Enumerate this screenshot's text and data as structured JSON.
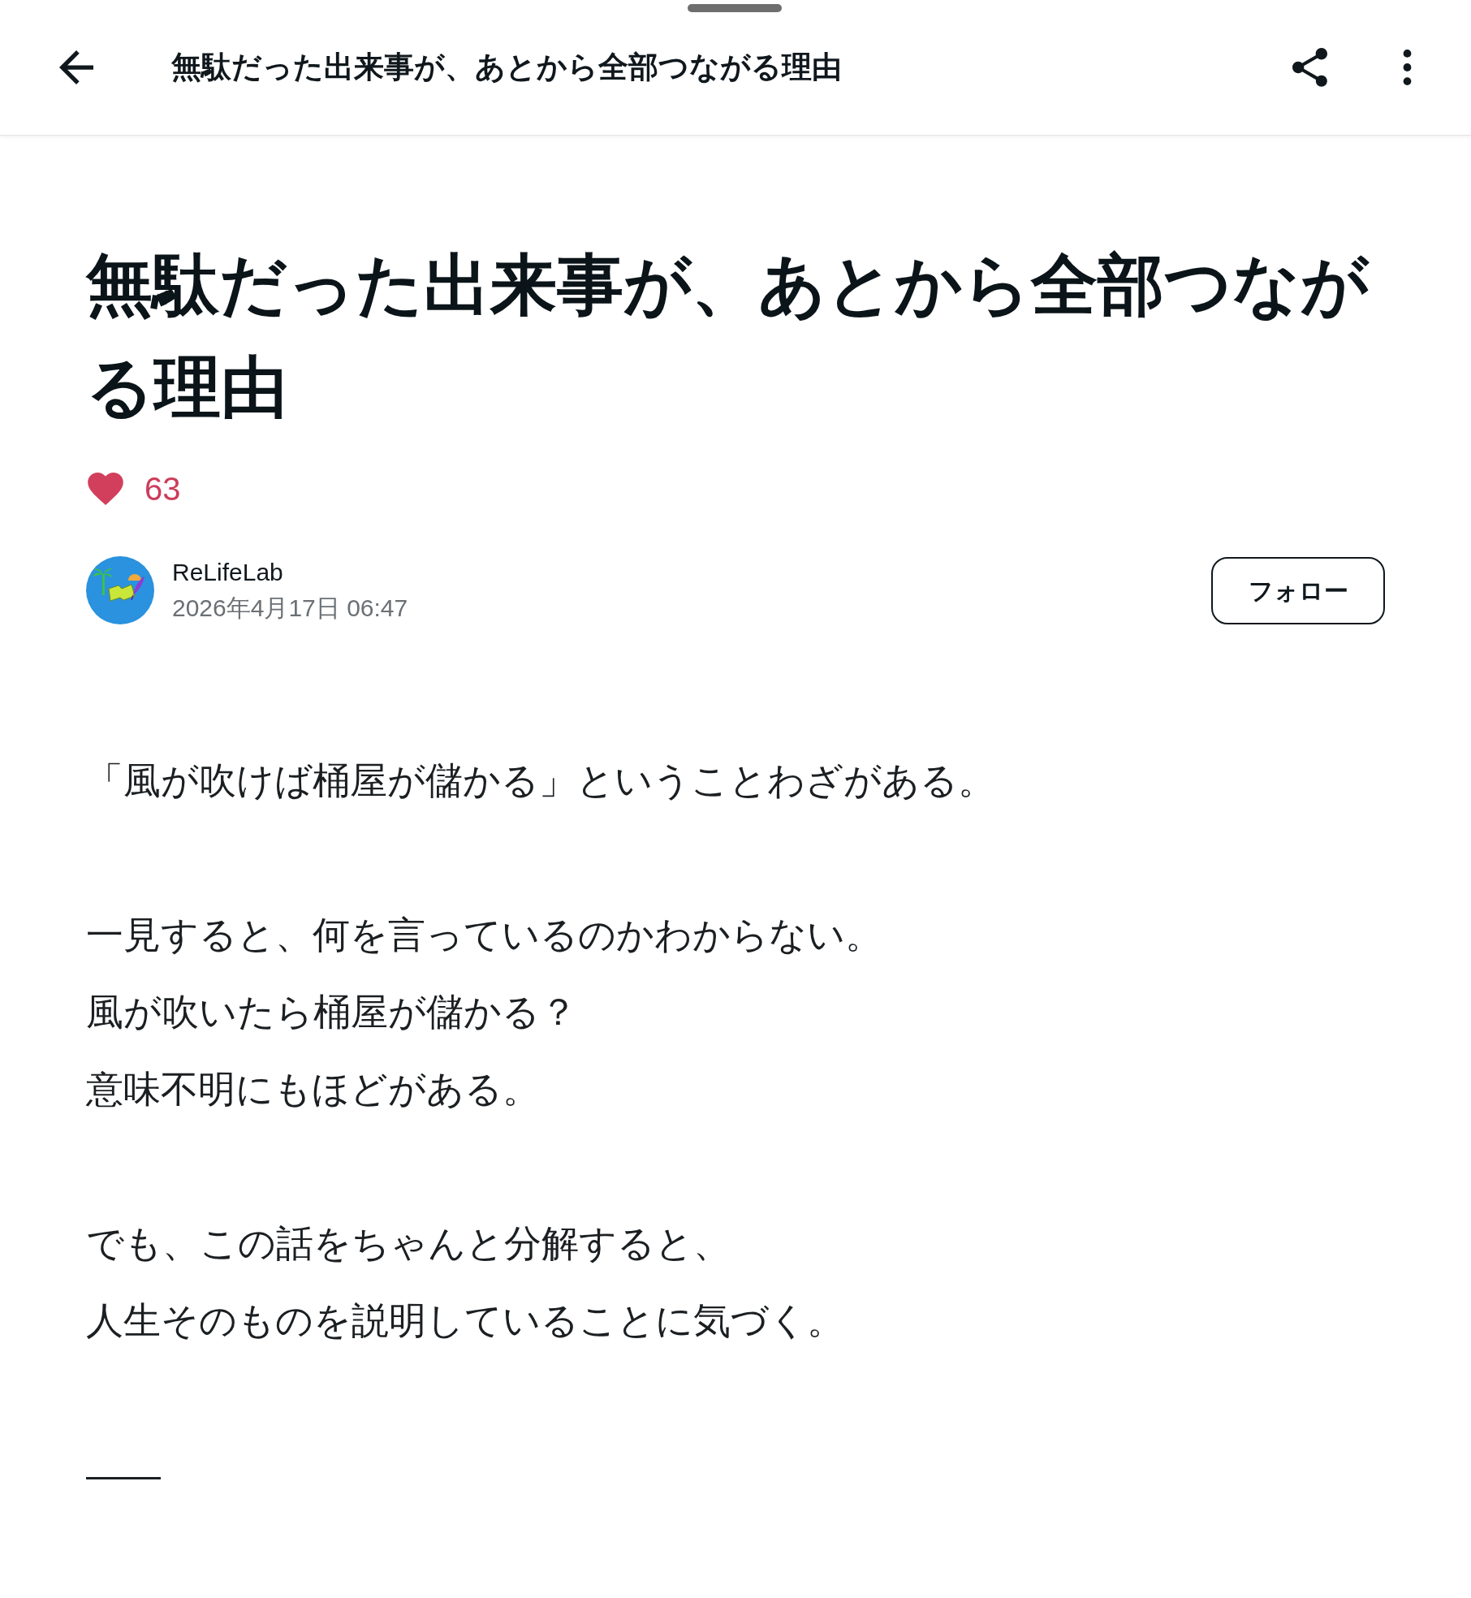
{
  "header": {
    "title": "無駄だった出来事が、あとから全部つながる理由"
  },
  "article": {
    "title": "無駄だった出来事が、あとから全部つながる理由",
    "likes": {
      "count": "63",
      "liked": true
    },
    "author": {
      "name": "ReLifeLab",
      "date": "2026年4月17日 06:47"
    },
    "follow_button": {
      "label": "フォロー"
    },
    "body": [
      {
        "lines": [
          "「風が吹けば桶屋が儲かる」ということわざがある。"
        ]
      },
      {
        "lines": [
          "一見すると、何を言っているのかわからない。",
          "風が吹いたら桶屋が儲かる？",
          "意味不明にもほどがある。"
        ]
      },
      {
        "lines": [
          "でも、この話をちゃんと分解すると、",
          "人生そのものを説明していることに気づく。"
        ]
      },
      {
        "lines": [
          "——"
        ]
      }
    ]
  }
}
